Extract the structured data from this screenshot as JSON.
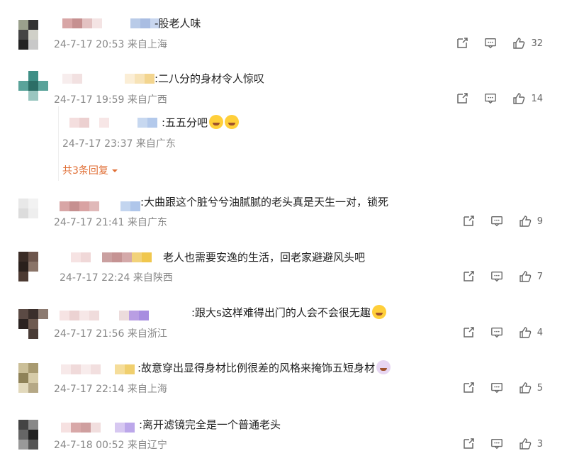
{
  "comments": [
    {
      "text": "-股老人味",
      "meta": "24-7-17 20:53 来自上海",
      "likes": "32"
    },
    {
      "text": ":二八分的身材令人惊叹",
      "meta": "24-7-17 19:59 来自广西",
      "likes": "14",
      "reply": {
        "text": ":五五分吧",
        "meta": "24-7-17 23:37 来自广东"
      },
      "expand": "共3条回复"
    },
    {
      "text": ":大曲跟这个脏兮兮油腻腻的老头真是天生一对，锁死",
      "meta": "24-7-17 21:41 来自广东",
      "likes": "9"
    },
    {
      "text": "老人也需要安逸的生活，回老家避避风头吧",
      "meta": "24-7-17 22:24 来自陕西",
      "likes": "7"
    },
    {
      "text": ":跟大s这样难得出门的人会不会很无趣",
      "meta": "24-7-17 21:56 来自浙江",
      "likes": "4"
    },
    {
      "text": ":故意穿出显得身材比例很差的风格来掩饰五短身材",
      "meta": "24-7-17 22:14 来自上海",
      "likes": "5"
    },
    {
      "text": ":离开滤镜完全是一个普通老头",
      "meta": "24-7-18 00:52 来自辽宁",
      "likes": "3"
    }
  ],
  "icons": {
    "share": "share-icon",
    "comment": "comment-icon",
    "like": "thumbs-up-icon",
    "emoji": "emoji-icon",
    "caret": "caret-down-icon"
  },
  "colors": {
    "accent": "#e06e34",
    "meta": "#888888"
  }
}
